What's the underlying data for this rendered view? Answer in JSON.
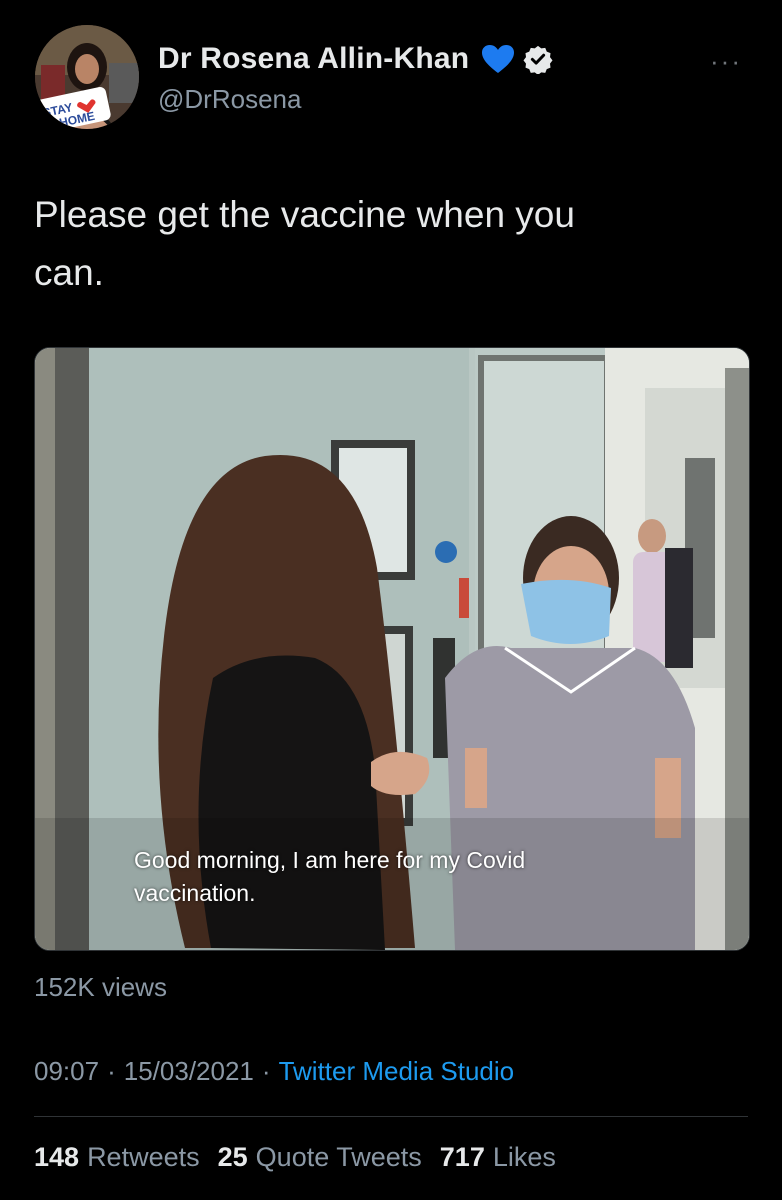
{
  "author": {
    "display_name": "Dr Rosena Allin-Khan",
    "handle": "@DrRosena",
    "emoji_icon": "blue-heart-icon",
    "verified_icon": "verified-badge-icon",
    "avatar_badge_line1": "STAY",
    "avatar_badge_line2": "HOME"
  },
  "more_menu": {
    "label": "···"
  },
  "tweet": {
    "text": "Please get the vaccine when you\ncan."
  },
  "media": {
    "caption": "Good morning, I am here for my Covid\nvaccination.",
    "views": "152K views"
  },
  "meta": {
    "time": "09:07",
    "separator": "·",
    "date": "15/03/2021",
    "source": "Twitter Media Studio"
  },
  "stats": {
    "retweets_count": "148",
    "retweets_label": "Retweets",
    "quotes_count": "25",
    "quotes_label": "Quote Tweets",
    "likes_count": "717",
    "likes_label": "Likes"
  },
  "colors": {
    "background": "#000000",
    "primary_text": "#e7e9ea",
    "secondary_text": "#8b98a5",
    "link": "#1d9bf0",
    "heart": "#1d7bf0"
  }
}
